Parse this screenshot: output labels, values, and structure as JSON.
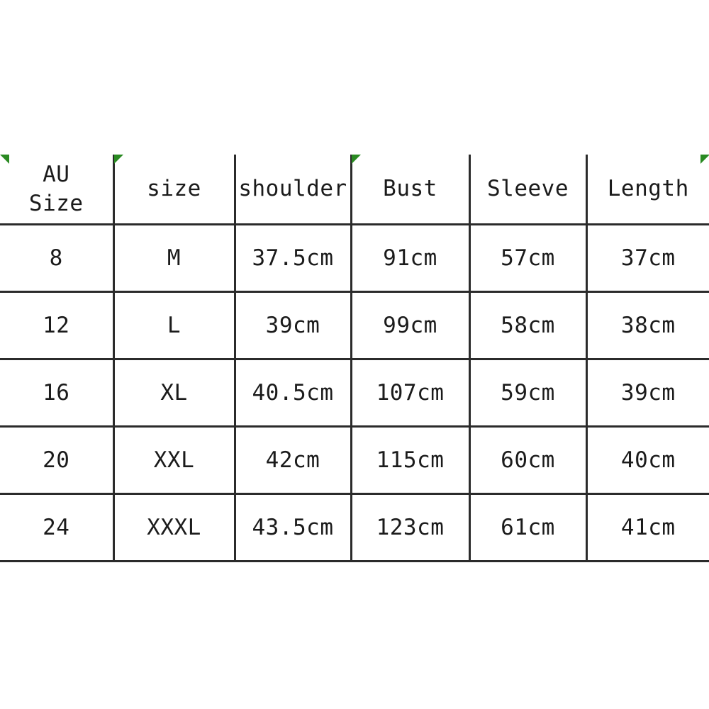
{
  "table": {
    "name": "size-chart",
    "columns": [
      {
        "key": "au_size",
        "label": "AU\nSize"
      },
      {
        "key": "size",
        "label": "size"
      },
      {
        "key": "shoulder",
        "label": "shoulder"
      },
      {
        "key": "bust",
        "label": "Bust"
      },
      {
        "key": "sleeve",
        "label": "Sleeve"
      },
      {
        "key": "length",
        "label": "Length"
      }
    ],
    "rows": [
      {
        "au_size": "8",
        "size": "M",
        "shoulder": "37.5cm",
        "bust": "91cm",
        "sleeve": "57cm",
        "length": "37cm"
      },
      {
        "au_size": "12",
        "size": "L",
        "shoulder": "39cm",
        "bust": "99cm",
        "sleeve": "58cm",
        "length": "38cm"
      },
      {
        "au_size": "16",
        "size": "XL",
        "shoulder": "40.5cm",
        "bust": "107cm",
        "sleeve": "59cm",
        "length": "39cm"
      },
      {
        "au_size": "20",
        "size": "XXL",
        "shoulder": "42cm",
        "bust": "115cm",
        "sleeve": "60cm",
        "length": "40cm"
      },
      {
        "au_size": "24",
        "size": "XXXL",
        "shoulder": "43.5cm",
        "bust": "123cm",
        "sleeve": "61cm",
        "length": "41cm"
      }
    ]
  },
  "markers": {
    "flag_color": "#2a8a22",
    "flags": [
      {
        "name": "green-flag-left-edge",
        "label": ""
      },
      {
        "name": "green-flag-size-rule",
        "label": ""
      },
      {
        "name": "green-flag-bust-rule",
        "label": ""
      },
      {
        "name": "green-flag-right-edge",
        "label": ""
      }
    ]
  },
  "colors": {
    "background": "#ffffff",
    "grid_line": "#2b2b2b",
    "text": "#1b1b1b",
    "accent_green": "#2a8a22"
  }
}
